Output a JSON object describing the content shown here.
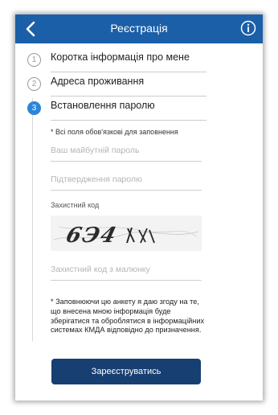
{
  "header": {
    "title": "Реєстрація",
    "back_icon": "chevron-left-icon",
    "info_icon": "info-icon",
    "background": "#1b5fa8"
  },
  "steps": [
    {
      "number": "1",
      "label": "Коротка інформація про мене",
      "state": "done"
    },
    {
      "number": "2",
      "label": "Адреса проживання",
      "state": "done"
    },
    {
      "number": "3",
      "label": "Встановлення паролю",
      "state": "active"
    }
  ],
  "form": {
    "required_note": "* Всі поля обов'язкові для заповнення",
    "password_placeholder": "Ваш майбутній пароль",
    "confirm_placeholder": "Підтвердження паролю",
    "captcha_label": "Захистний код",
    "captcha_text": "6Э4",
    "captcha_input_placeholder": "Захистний код з малюнку",
    "consent_text": "* Заповнюючи цю анкету я даю згоду на те, що внесена мною інформація буде зберігатися та оброблятися в інформаційних системах КМДА відповідно до призначення.",
    "submit_label": "Зареєструватись"
  },
  "colors": {
    "accent": "#2d85d8",
    "button": "#173f71"
  }
}
